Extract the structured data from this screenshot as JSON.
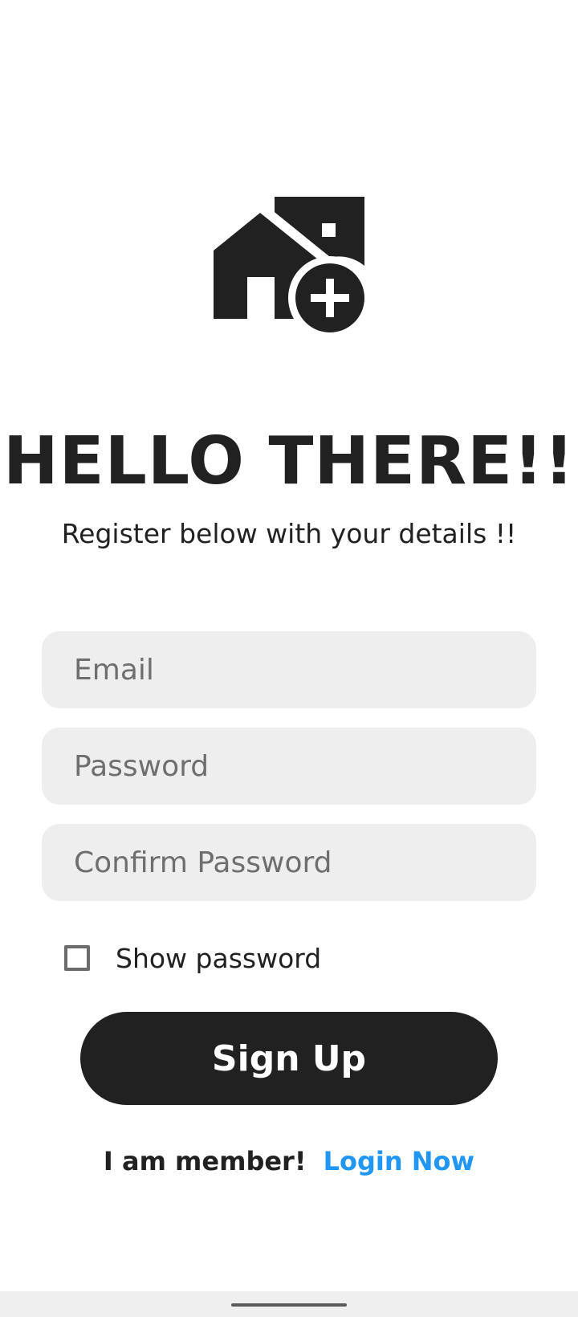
{
  "header": {
    "logo_icon": "add-home-icon",
    "title": "HELLO THERE!!",
    "subtitle": "Register below with your details !!"
  },
  "form": {
    "email_placeholder": "Email",
    "password_placeholder": "Password",
    "confirm_placeholder": "Confirm Password",
    "show_password_label": "Show password",
    "show_password_checked": false,
    "signup_label": "Sign Up"
  },
  "footer": {
    "member_text": "I am member!",
    "login_label": "Login Now"
  },
  "colors": {
    "primary": "#212121",
    "accent": "#2196f3",
    "field_bg": "#eeeeee"
  }
}
